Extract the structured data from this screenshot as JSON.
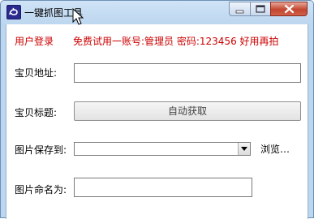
{
  "window": {
    "title": "一键抓图工具",
    "icon": "app-logo-icon",
    "controls": {
      "minimize_icon": "minimize-icon",
      "maximize_icon": "maximize-icon",
      "close_icon": "close-icon"
    }
  },
  "login": {
    "label": "用户登录",
    "hint": "免费试用一账号:管理员 密码:123456 好用再拍",
    "color": "#cc0000"
  },
  "form": {
    "baby_url_label": "宝贝地址:",
    "baby_url_value": "",
    "baby_title_label": "宝贝标题:",
    "auto_fetch_button": "自动获取",
    "save_to_label": "图片保存到:",
    "save_to_value": "",
    "browse_label": "浏览…",
    "name_as_label": "图片命名为:",
    "name_as_value": ""
  }
}
